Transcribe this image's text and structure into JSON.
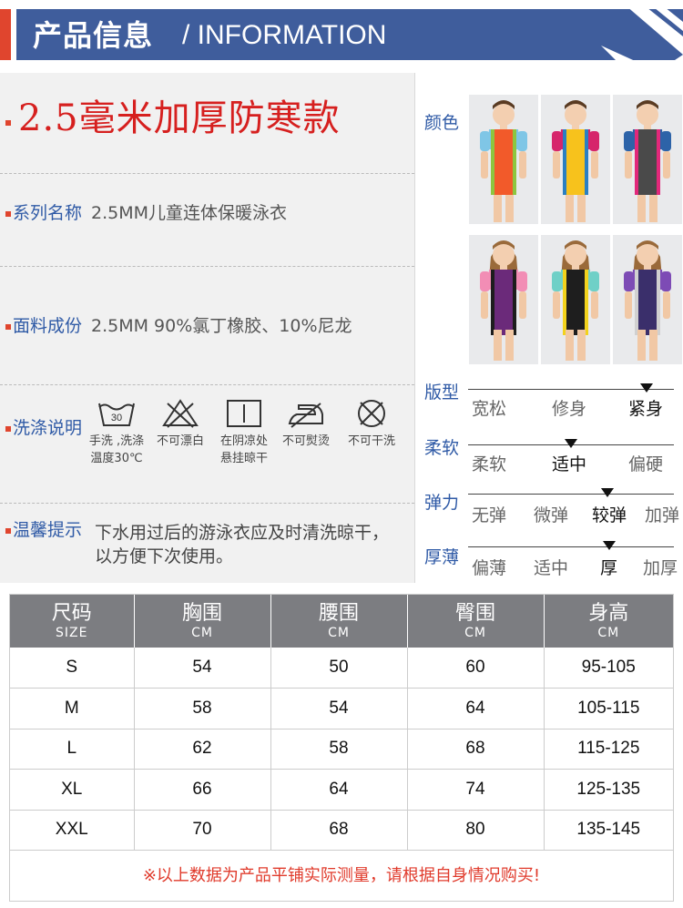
{
  "header": {
    "title": "产品信息",
    "subtitle": "/ INFORMATION",
    "accent_color": "#e0452e",
    "bar_color": "#3f5d9c"
  },
  "info": {
    "heading": "2.5毫米加厚防寒款",
    "series_label": "系列名称",
    "series_value": "2.5MM儿童连体保暖泳衣",
    "fabric_label": "面料成份",
    "fabric_value": "2.5MM 90%氯丁橡胶、10%尼龙",
    "wash_label": "洗涤说明",
    "wash_items": [
      {
        "icon": "hand-wash-30-icon",
        "temp": "30",
        "line1": "手洗 ,洗涤",
        "line2": "温度30℃"
      },
      {
        "icon": "no-bleach-icon",
        "line1": "不可漂白",
        "line2": ""
      },
      {
        "icon": "line-dry-shade-icon",
        "line1": "在阴凉处",
        "line2": "悬挂晾干"
      },
      {
        "icon": "no-iron-icon",
        "line1": "不可熨烫",
        "line2": ""
      },
      {
        "icon": "no-dry-clean-icon",
        "line1": "不可干洗",
        "line2": ""
      }
    ],
    "tip_label": "温馨提示",
    "tip_value": "下水用过后的游泳衣应及时清洗晾干，以方便下次使用。"
  },
  "attributes": {
    "color_label": "颜色",
    "photos": [
      {
        "name": "boy-orange",
        "body": "#f25a2a",
        "sleeve": "#7fc6e6",
        "trim": "#8dc63f"
      },
      {
        "name": "boy-yellow",
        "body": "#f7c21c",
        "sleeve": "#d6256b",
        "trim": "#2a7fc2"
      },
      {
        "name": "boy-gray",
        "body": "#4a4a4a",
        "sleeve": "#2d63a8",
        "trim": "#e2287a"
      },
      {
        "name": "girl-pink",
        "body": "#6b2a7a",
        "sleeve": "#f28db5",
        "trim": "#1d1d1d"
      },
      {
        "name": "girl-teal",
        "body": "#1e1e1e",
        "sleeve": "#6fd0c7",
        "trim": "#f2d21d"
      },
      {
        "name": "girl-purple",
        "body": "#3a2f6b",
        "sleeve": "#7d4bb5",
        "trim": "#d0d0d0"
      }
    ],
    "scales": [
      {
        "label": "版型",
        "options": [
          "宽松",
          "修身",
          "紧身"
        ],
        "selected": 2
      },
      {
        "label": "柔软",
        "options": [
          "柔软",
          "适中",
          "偏硬"
        ],
        "selected": 1
      },
      {
        "label": "弹力",
        "options": [
          "无弹",
          "微弹",
          "较弹",
          "加弹"
        ],
        "selected": 2
      },
      {
        "label": "厚薄",
        "options": [
          "偏薄",
          "适中",
          "厚",
          "加厚"
        ],
        "selected": 2
      }
    ]
  },
  "size_table": {
    "headers": [
      {
        "zh": "尺码",
        "en": "SIZE"
      },
      {
        "zh": "胸围",
        "en": "CM"
      },
      {
        "zh": "腰围",
        "en": "CM"
      },
      {
        "zh": "臀围",
        "en": "CM"
      },
      {
        "zh": "身高",
        "en": "CM"
      }
    ],
    "rows": [
      [
        "S",
        "54",
        "50",
        "60",
        "95-105"
      ],
      [
        "M",
        "58",
        "54",
        "64",
        "105-115"
      ],
      [
        "L",
        "62",
        "58",
        "68",
        "115-125"
      ],
      [
        "XL",
        "66",
        "64",
        "74",
        "125-135"
      ],
      [
        "XXL",
        "70",
        "68",
        "80",
        "135-145"
      ]
    ],
    "note": "※以上数据为产品平铺实际测量，请根据自身情况购买!"
  }
}
